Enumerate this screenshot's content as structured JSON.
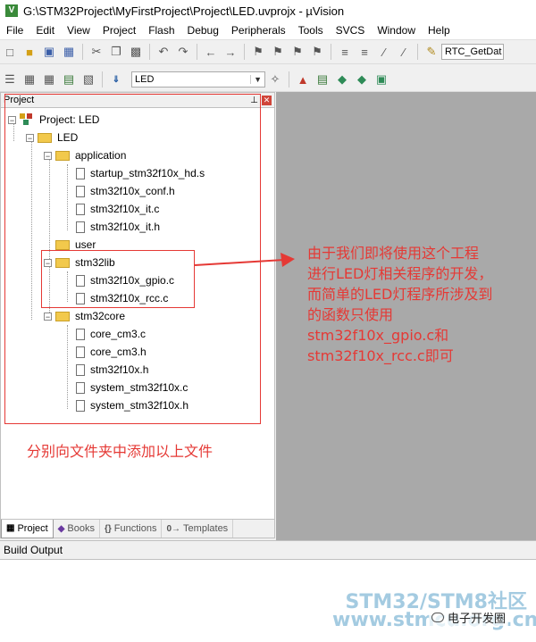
{
  "window": {
    "title": "G:\\STM32Project\\MyFirstProject\\Project\\LED.uvprojx - µVision"
  },
  "menu": [
    {
      "label": "File"
    },
    {
      "label": "Edit"
    },
    {
      "label": "View"
    },
    {
      "label": "Project"
    },
    {
      "label": "Flash"
    },
    {
      "label": "Debug"
    },
    {
      "label": "Peripherals"
    },
    {
      "label": "Tools"
    },
    {
      "label": "SVCS"
    },
    {
      "label": "Window"
    },
    {
      "label": "Help"
    }
  ],
  "toolbar": {
    "find_combo_value": "RTC_GetDat",
    "target_combo_value": "LED"
  },
  "project_panel": {
    "title": "Project",
    "tree": [
      {
        "label": "Project: LED",
        "kind": "project",
        "level": 0
      },
      {
        "label": "LED",
        "kind": "target",
        "level": 1
      },
      {
        "label": "application",
        "kind": "folder",
        "level": 2
      },
      {
        "label": "startup_stm32f10x_hd.s",
        "kind": "file",
        "level": 3
      },
      {
        "label": "stm32f10x_conf.h",
        "kind": "file",
        "level": 3
      },
      {
        "label": "stm32f10x_it.c",
        "kind": "file",
        "level": 3
      },
      {
        "label": "stm32f10x_it.h",
        "kind": "file",
        "level": 3
      },
      {
        "label": "user",
        "kind": "folder",
        "level": 2
      },
      {
        "label": "stm32lib",
        "kind": "folder",
        "level": 2
      },
      {
        "label": "stm32f10x_gpio.c",
        "kind": "file",
        "level": 3
      },
      {
        "label": "stm32f10x_rcc.c",
        "kind": "file",
        "level": 3
      },
      {
        "label": "stm32core",
        "kind": "folder",
        "level": 2
      },
      {
        "label": "core_cm3.c",
        "kind": "file",
        "level": 3
      },
      {
        "label": "core_cm3.h",
        "kind": "file",
        "level": 3
      },
      {
        "label": "stm32f10x.h",
        "kind": "file",
        "level": 3
      },
      {
        "label": "system_stm32f10x.c",
        "kind": "file",
        "level": 3
      },
      {
        "label": "system_stm32f10x.h",
        "kind": "file",
        "level": 3
      }
    ],
    "tabs": [
      {
        "label": "Project",
        "active": true
      },
      {
        "label": "Books",
        "active": false
      },
      {
        "label": "Functions",
        "active": false
      },
      {
        "label": "Templates",
        "active": false
      }
    ]
  },
  "build_output": {
    "title": "Build Output"
  },
  "annotations": {
    "main_note_lines": [
      "由于我们即将使用这个工程",
      "进行LED灯相关程序的开发，",
      "而简单的LED灯程序所涉及到",
      "的函数只使用",
      "stm32f10x_gpio.c和",
      "stm32f10x_rcc.c即可"
    ],
    "bottom_note": "分别向文件夹中添加以上文件",
    "color": "#e53935"
  },
  "watermark": {
    "line1": "STM32/STM8社区",
    "line2": "www.stmcu.org.cn",
    "wechat": "电子开发圈"
  }
}
